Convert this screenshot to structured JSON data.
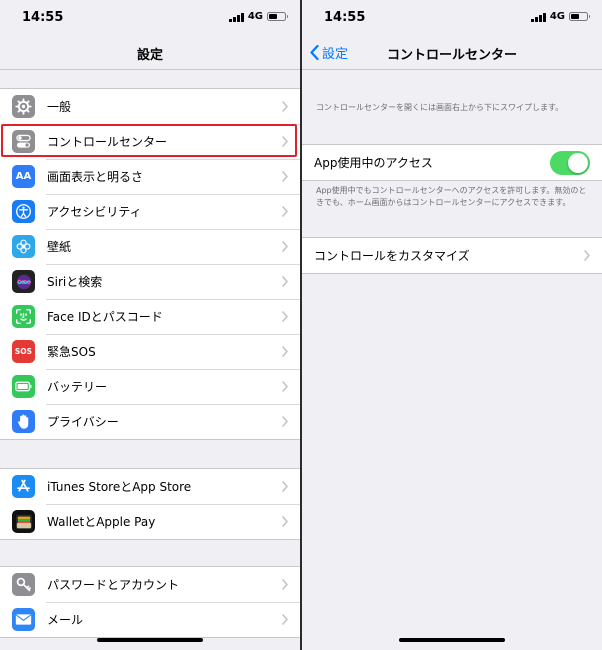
{
  "status": {
    "time": "14:55",
    "network": "4G"
  },
  "left": {
    "title": "設定",
    "groups": [
      {
        "items": [
          {
            "label": "一般",
            "icon": "gear-icon",
            "color": "#8e8e93"
          },
          {
            "label": "コントロールセンター",
            "icon": "toggles-icon",
            "color": "#8e8e93",
            "highlighted": true
          },
          {
            "label": "画面表示と明るさ",
            "icon": "text-size-icon",
            "color": "#2f7cf6",
            "glyph": "AA"
          },
          {
            "label": "アクセシビリティ",
            "icon": "accessibility-icon",
            "color": "#1a7cf5"
          },
          {
            "label": "壁紙",
            "icon": "wallpaper-flower-icon",
            "color": "#2da8e8"
          },
          {
            "label": "Siriと検索",
            "icon": "siri-icon",
            "color": "#222222"
          },
          {
            "label": "Face IDとパスコード",
            "icon": "face-id-icon",
            "color": "#34c759"
          },
          {
            "label": "緊急SOS",
            "icon": "sos-icon",
            "color": "#e53935",
            "glyph": "SOS"
          },
          {
            "label": "バッテリー",
            "icon": "battery-icon",
            "color": "#34c759"
          },
          {
            "label": "プライバシー",
            "icon": "hand-icon",
            "color": "#2f7cf6"
          }
        ]
      },
      {
        "items": [
          {
            "label": "iTunes StoreとApp Store",
            "icon": "app-store-icon",
            "color": "#1b8cf2"
          },
          {
            "label": "WalletとApple Pay",
            "icon": "wallet-icon",
            "color": "#111111"
          }
        ]
      },
      {
        "items": [
          {
            "label": "パスワードとアカウント",
            "icon": "key-icon",
            "color": "#8e8e93"
          },
          {
            "label": "メール",
            "icon": "mail-icon",
            "color": "#2f86f6"
          }
        ]
      }
    ]
  },
  "right": {
    "back_label": "設定",
    "title": "コントロールセンター",
    "top_note": "コントロールセンターを開くには画面右上から下にスワイプします。",
    "toggle_label": "App使用中のアクセス",
    "toggle_on": true,
    "toggle_note": "App使用中でもコントロールセンターへのアクセスを許可します。無効のときでも、ホーム画面からはコントロールセンターにアクセスできます。",
    "customize_label": "コントロールをカスタマイズ"
  }
}
